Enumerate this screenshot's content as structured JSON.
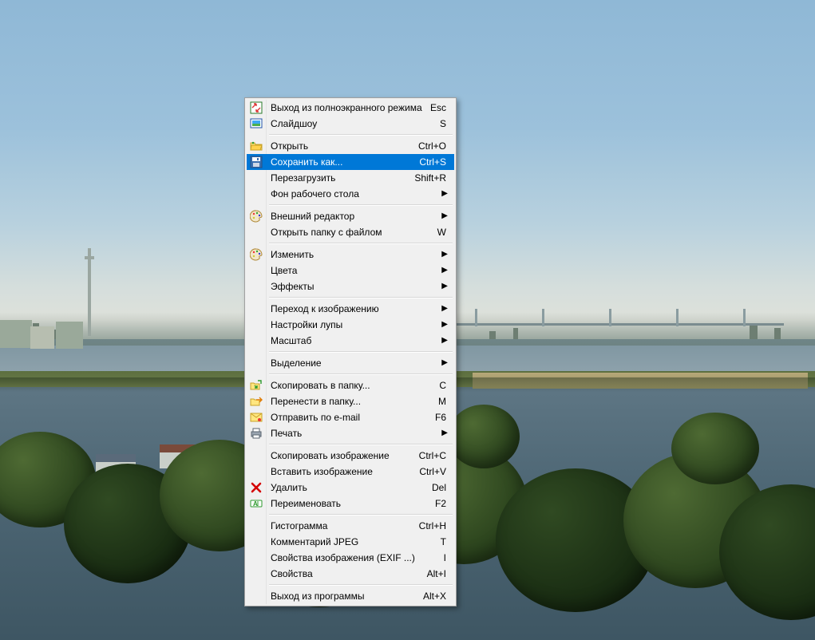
{
  "menu": {
    "groups": [
      [
        {
          "id": "exit-fullscreen",
          "icon": "fullscreen-exit",
          "label": "Выход из полноэкранного режима",
          "shortcut": "Esc",
          "submenu": false
        },
        {
          "id": "slideshow",
          "icon": "slideshow",
          "label": "Слайдшоу",
          "shortcut": "S",
          "submenu": false
        }
      ],
      [
        {
          "id": "open",
          "icon": "folder-open",
          "label": "Открыть",
          "shortcut": "Ctrl+O",
          "submenu": false
        },
        {
          "id": "save-as",
          "icon": "save",
          "label": "Сохранить как...",
          "shortcut": "Ctrl+S",
          "submenu": false,
          "hl": true
        },
        {
          "id": "reload",
          "icon": "",
          "label": "Перезагрузить",
          "shortcut": "Shift+R",
          "submenu": false
        },
        {
          "id": "wallpaper",
          "icon": "",
          "label": "Фон рабочего стола",
          "shortcut": "",
          "submenu": true
        }
      ],
      [
        {
          "id": "external-editor",
          "icon": "palette",
          "label": "Внешний редактор",
          "shortcut": "",
          "submenu": true
        },
        {
          "id": "open-folder",
          "icon": "",
          "label": "Открыть папку с файлом",
          "shortcut": "W",
          "submenu": false
        }
      ],
      [
        {
          "id": "edit",
          "icon": "palette",
          "label": "Изменить",
          "shortcut": "",
          "submenu": true
        },
        {
          "id": "colors",
          "icon": "",
          "label": "Цвета",
          "shortcut": "",
          "submenu": true
        },
        {
          "id": "effects",
          "icon": "",
          "label": "Эффекты",
          "shortcut": "",
          "submenu": true
        }
      ],
      [
        {
          "id": "goto-image",
          "icon": "",
          "label": "Переход к изображению",
          "shortcut": "",
          "submenu": true
        },
        {
          "id": "loupe",
          "icon": "",
          "label": "Настройки лупы",
          "shortcut": "",
          "submenu": true
        },
        {
          "id": "zoom",
          "icon": "",
          "label": "Масштаб",
          "shortcut": "",
          "submenu": true
        }
      ],
      [
        {
          "id": "selection",
          "icon": "",
          "label": "Выделение",
          "shortcut": "",
          "submenu": true
        }
      ],
      [
        {
          "id": "copy-to",
          "icon": "copy-folder",
          "label": "Скопировать в папку...",
          "shortcut": "C",
          "submenu": false
        },
        {
          "id": "move-to",
          "icon": "move-folder",
          "label": "Перенести в папку...",
          "shortcut": "M",
          "submenu": false
        },
        {
          "id": "email",
          "icon": "mail",
          "label": "Отправить по e-mail",
          "shortcut": "F6",
          "submenu": false
        },
        {
          "id": "print",
          "icon": "printer",
          "label": "Печать",
          "shortcut": "",
          "submenu": true
        }
      ],
      [
        {
          "id": "copy-image",
          "icon": "",
          "label": "Скопировать изображение",
          "shortcut": "Ctrl+C",
          "submenu": false
        },
        {
          "id": "paste-image",
          "icon": "",
          "label": "Вставить изображение",
          "shortcut": "Ctrl+V",
          "submenu": false
        },
        {
          "id": "delete",
          "icon": "delete",
          "label": "Удалить",
          "shortcut": "Del",
          "submenu": false
        },
        {
          "id": "rename",
          "icon": "rename",
          "label": "Переименовать",
          "shortcut": "F2",
          "submenu": false
        }
      ],
      [
        {
          "id": "histogram",
          "icon": "",
          "label": "Гистограмма",
          "shortcut": "Ctrl+H",
          "submenu": false
        },
        {
          "id": "jpeg-comment",
          "icon": "",
          "label": "Комментарий JPEG",
          "shortcut": "T",
          "submenu": false
        },
        {
          "id": "exif",
          "icon": "",
          "label": "Свойства изображения (EXIF ...)",
          "shortcut": "I",
          "submenu": false
        },
        {
          "id": "properties",
          "icon": "",
          "label": "Свойства",
          "shortcut": "Alt+I",
          "submenu": false
        }
      ],
      [
        {
          "id": "exit",
          "icon": "",
          "label": "Выход из программы",
          "shortcut": "Alt+X",
          "submenu": false
        }
      ]
    ]
  }
}
